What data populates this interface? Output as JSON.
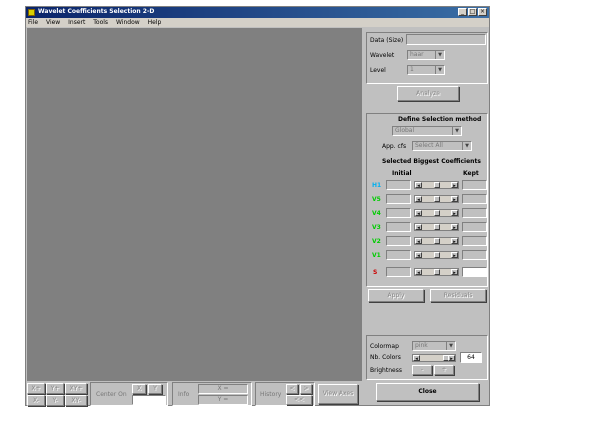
{
  "window": {
    "title": "Wavelet Coefficients Selection 2-D",
    "controls": {
      "minimize": "_",
      "maximize": "□",
      "close": "×"
    }
  },
  "menu": [
    "File",
    "View",
    "Insert",
    "Tools",
    "Window",
    "Help"
  ],
  "panel": {
    "data_label": "Data  (Size)",
    "data_value": "",
    "wavelet_label": "Wavelet",
    "wavelet_value": "haar",
    "level_label": "Level",
    "level_value": "1",
    "analyze_label": "Analyze",
    "define_title": "Define Selection method",
    "method_value": "Global",
    "app_label": "App. cfs",
    "app_value": "Select All",
    "selected_title": "Selected Biggest Coefficients",
    "initial_label": "Initial",
    "kept_label": "Kept",
    "rows": [
      {
        "label": "H1",
        "color": "#00b0f0"
      },
      {
        "label": "V5",
        "color": "#00cc00"
      },
      {
        "label": "V4",
        "color": "#00cc00"
      },
      {
        "label": "V3",
        "color": "#00cc00"
      },
      {
        "label": "V2",
        "color": "#00cc00"
      },
      {
        "label": "V1",
        "color": "#00cc00"
      }
    ],
    "s_label": "S",
    "s_color": "#cc0000",
    "apply_label": "Apply",
    "residuals_label": "Residuals",
    "colormap_label": "Colormap",
    "colormap_value": "pink",
    "nbcolors_label": "Nb. Colors",
    "nbcolors_value": "64",
    "brightness_label": "Brightness",
    "brightness_minus": "-",
    "brightness_plus": "+",
    "close_label": "Close"
  },
  "bottom": {
    "xplus": "X+",
    "yplus": "Y+",
    "xyplus": "XY+",
    "xminus": "X-",
    "yminus": "Y-",
    "xyminus": "XY-",
    "center_on": "Center On",
    "x": "X",
    "y": "Y",
    "info": "Info",
    "x_eq": "X =",
    "y_eq": "Y =",
    "history": "History",
    "hist_prev": "<",
    "hist_next": ">",
    "hist_back": "<<",
    "view_axes": "View Axes"
  }
}
